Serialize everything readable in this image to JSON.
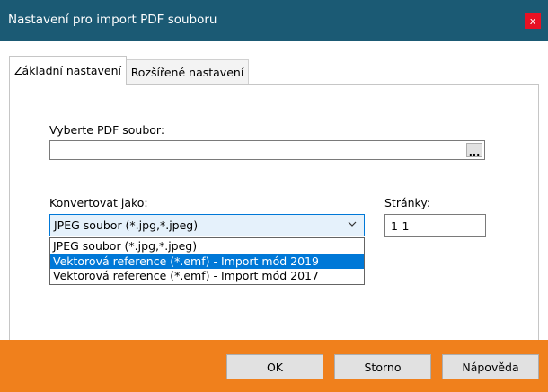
{
  "window": {
    "title": "Nastavení pro import PDF souboru",
    "close_glyph": "x"
  },
  "tabs": [
    {
      "label": "Základní nastavení",
      "active": true
    },
    {
      "label": "Rozšířené nastavení",
      "active": false
    }
  ],
  "form": {
    "pdf_label": "Vyberte PDF soubor:",
    "pdf_value": "",
    "browse_label": "...",
    "convert_label": "Konvertovat jako:",
    "convert_selected": "JPEG soubor (*.jpg,*.jpeg)",
    "convert_options": [
      {
        "label": "JPEG soubor (*.jpg,*.jpeg)",
        "highlighted": false
      },
      {
        "label": "Vektorová reference (*.emf) - Import mód 2019",
        "highlighted": true
      },
      {
        "label": "Vektorová reference (*.emf) - Import mód 2017",
        "highlighted": false
      }
    ],
    "pages_label": "Stránky:",
    "pages_value": "1-1"
  },
  "buttons": {
    "ok": "OK",
    "cancel": "Storno",
    "help": "Nápověda"
  },
  "colors": {
    "titlebar": "#1b5a74",
    "footer": "#f0801c",
    "selection": "#0078d7",
    "close": "#e81123"
  },
  "icons": {
    "combo_chevron": "chevron-down-icon"
  }
}
